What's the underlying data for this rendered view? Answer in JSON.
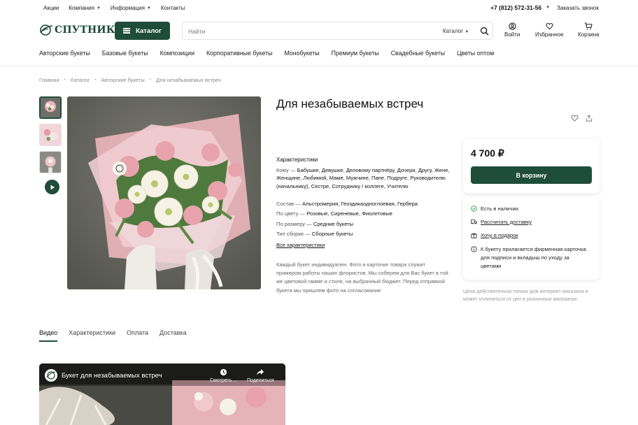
{
  "topbar": {
    "links": [
      "Акции",
      "Компания",
      "Информация",
      "Контакты"
    ],
    "phone": "+7 (812) 572-31-56",
    "callback": "Заказать звонок"
  },
  "header": {
    "logo_text": "СПУТНИК",
    "catalog_label": "Каталог",
    "search_placeholder": "Найти",
    "search_category": "Каталог",
    "login": "Войти",
    "favorites": "Избранное",
    "cart": "Корзина"
  },
  "nav": [
    "Авторские букеты",
    "Базовые букеты",
    "Композиции",
    "Корпоративные букеты",
    "Монобукеты",
    "Премиум букеты",
    "Свадебные букеты",
    "Цветы оптом"
  ],
  "breadcrumb": [
    "Главная",
    "Каталог",
    "Авторские букеты",
    "Для незабываемых встреч"
  ],
  "product": {
    "title": "Для незабываемых встреч",
    "chars_heading": "Характеристики",
    "whom_label": "Кому —",
    "whom_value": "Бабушке, Девушке, Деловому партнёру, Дочери, Другу, Жене, Женщине, Любимой, Маме, Мужчине, Папе, Подруге, Руководителю (начальнику), Сестре, Сотруднику / коллеге, Учителю",
    "composition_label": "Состав —",
    "composition_value": "Альстромерия, Геоздикаодноглоевая, Гербера",
    "color_label": "По цвету —",
    "color_value": "Розовые, Сиреневые, Фиолетовые",
    "size_label": "По размеру —",
    "size_value": "Средние букеты",
    "assembly_label": "Тип сборки —",
    "assembly_value": "Сборные букеты",
    "all_chars": "Все характеристики",
    "description": "Каждый букет индивидуален. Фото в карточке товара служит примером работы наших флористов. Мы соберем для Вас букет в той же цветовой гамме и стиле, на выбранный бюджет. Перед отправкой букета мы пришлем фото на согласование"
  },
  "purchase": {
    "price": "4 700 ₽",
    "add_to_cart": "В корзину",
    "in_stock": "Есть в наличии",
    "delivery_calc": "Рассчитать доставку",
    "gift_wish": "Хочу в подарок",
    "card_note": "К букету прилагается фирменная карточка для подписи и вкладыш по уходу за цветами",
    "price_note": "Цена действительна только для интернет-магазина и может отличаться от цен в розничных магазинах"
  },
  "tabs": [
    "Видео",
    "Характеристики",
    "Оплата",
    "Доставка"
  ],
  "video": {
    "title": "Букет для незабываемых встреч",
    "watch_later": "Смотреть ...",
    "share": "Поделиться"
  },
  "colors": {
    "brand": "#1f4d3c",
    "stock_green": "#3aa34a"
  }
}
